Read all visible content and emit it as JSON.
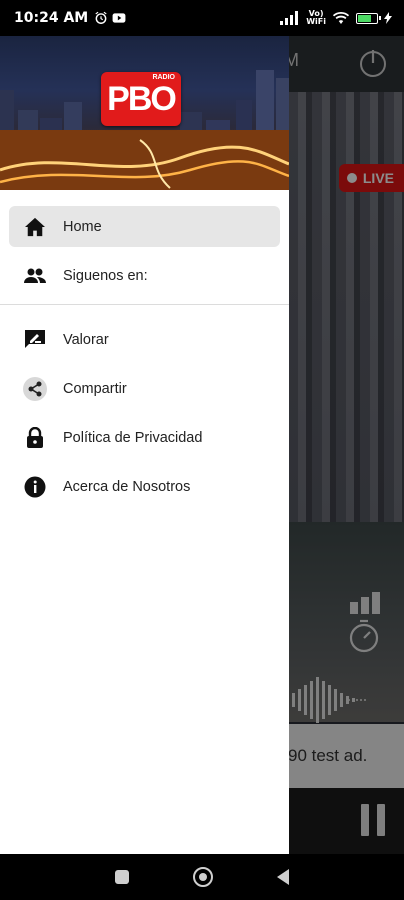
{
  "status_bar": {
    "time": "10:24 AM",
    "volte_top": "Vo)",
    "volte_bottom": "WiFi",
    "icons": [
      "alarm-icon",
      "youtube-icon",
      "signal-icon",
      "wifi-icon",
      "battery-icon"
    ],
    "battery_level": 0.7
  },
  "background_app": {
    "toolbar_partial_title": "M",
    "live_label": "LIVE",
    "ad_text": "90 test ad.",
    "colors": {
      "live": "#e01515",
      "logo": "#e11b1b"
    }
  },
  "drawer": {
    "logo": {
      "text": "PBO",
      "subtext": "RADIO"
    },
    "menu": [
      {
        "label": "Home",
        "icon": "home-icon",
        "active": true
      },
      {
        "label": "Siguenos en:",
        "icon": "people-icon",
        "active": false
      },
      {
        "label": "Valorar",
        "icon": "rate-icon",
        "active": false
      },
      {
        "label": "Compartir",
        "icon": "share-icon",
        "active": false
      },
      {
        "label": "Política de Privacidad",
        "icon": "lock-icon",
        "active": false
      },
      {
        "label": "Acerca de Nosotros",
        "icon": "info-icon",
        "active": false
      }
    ]
  },
  "nav_bar": {
    "buttons": [
      "recents-button",
      "home-button",
      "back-button"
    ]
  }
}
